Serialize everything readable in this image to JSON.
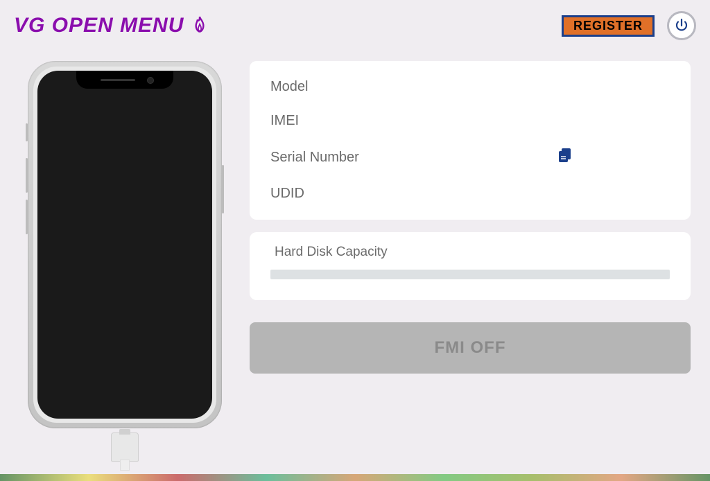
{
  "header": {
    "title": "VG OPEN MENU",
    "register_label": "REGISTER"
  },
  "info": {
    "model_label": "Model",
    "imei_label": "IMEI",
    "serial_label": "Serial Number",
    "udid_label": "UDID"
  },
  "storage": {
    "label": "Hard Disk Capacity"
  },
  "actions": {
    "fmi_label": "FMI OFF"
  },
  "colors": {
    "accent": "#8A0DAD",
    "register_bg": "#E07028",
    "register_border": "#1B3F8B"
  }
}
